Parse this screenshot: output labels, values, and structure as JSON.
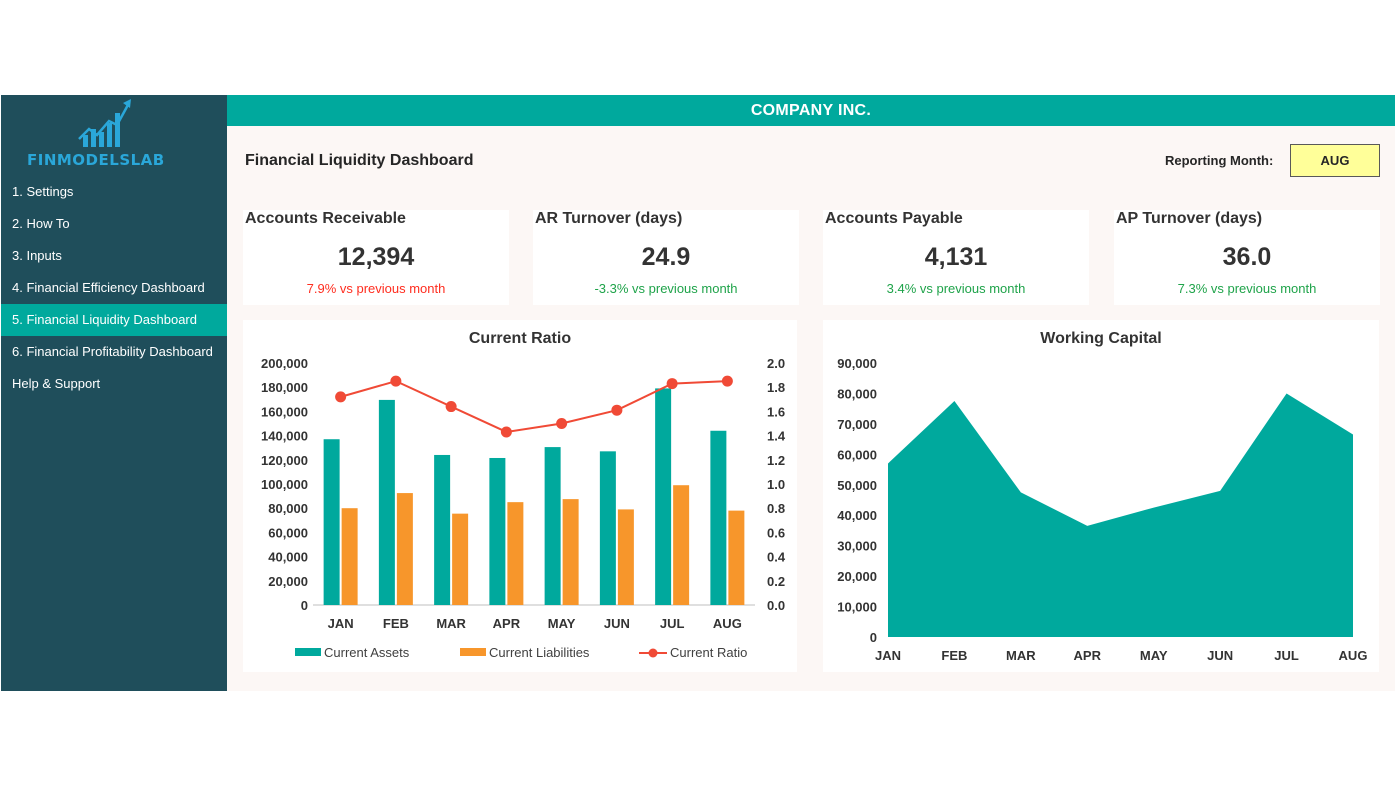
{
  "sidebar": {
    "logo_text": "FINMODELSLAB",
    "items": [
      {
        "label": "1. Settings",
        "active": false
      },
      {
        "label": "2. How To",
        "active": false
      },
      {
        "label": "3. Inputs",
        "active": false
      },
      {
        "label": "4. Financial Efficiency Dashboard",
        "active": false
      },
      {
        "label": "5. Financial Liquidity Dashboard",
        "active": true
      },
      {
        "label": "6. Financial Profitability Dashboard",
        "active": false
      },
      {
        "label": "Help & Support",
        "active": false
      }
    ]
  },
  "header": {
    "company": "COMPANY INC.",
    "page_title": "Financial Liquidity Dashboard",
    "reporting_month_label": "Reporting Month:",
    "reporting_month_value": "AUG"
  },
  "kpis": [
    {
      "title": "Accounts Receivable",
      "value": "12,394",
      "delta": "7.9% vs previous month",
      "delta_color": "#ff2d1f"
    },
    {
      "title": "AR Turnover (days)",
      "value": "24.9",
      "delta": "-3.3% vs previous month",
      "delta_color": "#1fa34a"
    },
    {
      "title": "Accounts Payable",
      "value": "4,131",
      "delta": "3.4% vs previous month",
      "delta_color": "#1fa34a"
    },
    {
      "title": "AP Turnover (days)",
      "value": "36.0",
      "delta": "7.3% vs previous month",
      "delta_color": "#1fa34a"
    }
  ],
  "colors": {
    "teal": "#00a99d",
    "orange": "#f7962b",
    "red": "#f04a36",
    "sidebar": "#1f4e5b"
  },
  "chart_data": [
    {
      "type": "bar",
      "title": "Current Ratio",
      "categories": [
        "JAN",
        "FEB",
        "MAR",
        "APR",
        "MAY",
        "JUN",
        "JUL",
        "AUG"
      ],
      "series": [
        {
          "name": "Current Assets",
          "type": "bar",
          "axis": "left",
          "color": "#00a99d",
          "values": [
            137000,
            169500,
            124000,
            121500,
            130500,
            127000,
            179000,
            144000
          ]
        },
        {
          "name": "Current Liabilities",
          "type": "bar",
          "axis": "left",
          "color": "#f7962b",
          "values": [
            80000,
            92500,
            75500,
            85000,
            87500,
            79000,
            99000,
            78000
          ]
        },
        {
          "name": "Current Ratio",
          "type": "line",
          "axis": "right",
          "color": "#f04a36",
          "values": [
            1.72,
            1.85,
            1.64,
            1.43,
            1.5,
            1.61,
            1.83,
            1.85
          ]
        }
      ],
      "ylim": [
        0,
        200000
      ],
      "yticks": [
        "200,000",
        "180,000",
        "160,000",
        "140,000",
        "120,000",
        "100,000",
        "80,000",
        "60,000",
        "40,000",
        "20,000",
        "0"
      ],
      "y2lim": [
        0,
        2
      ],
      "y2ticks": [
        "2.0",
        "1.8",
        "1.6",
        "1.4",
        "1.2",
        "1.0",
        "0.8",
        "0.6",
        "0.4",
        "0.2",
        "0.0"
      ],
      "legend": "bottom",
      "grid": false
    },
    {
      "type": "area",
      "title": "Working Capital",
      "categories": [
        "JAN",
        "FEB",
        "MAR",
        "APR",
        "MAY",
        "JUN",
        "JUL",
        "AUG"
      ],
      "values": [
        57000,
        77500,
        47500,
        36500,
        42500,
        48000,
        80000,
        66500
      ],
      "ylim": [
        0,
        90000
      ],
      "yticks": [
        "90,000",
        "80,000",
        "70,000",
        "60,000",
        "50,000",
        "40,000",
        "30,000",
        "20,000",
        "10,000",
        "0"
      ],
      "color": "#00a99d",
      "grid": false
    }
  ]
}
